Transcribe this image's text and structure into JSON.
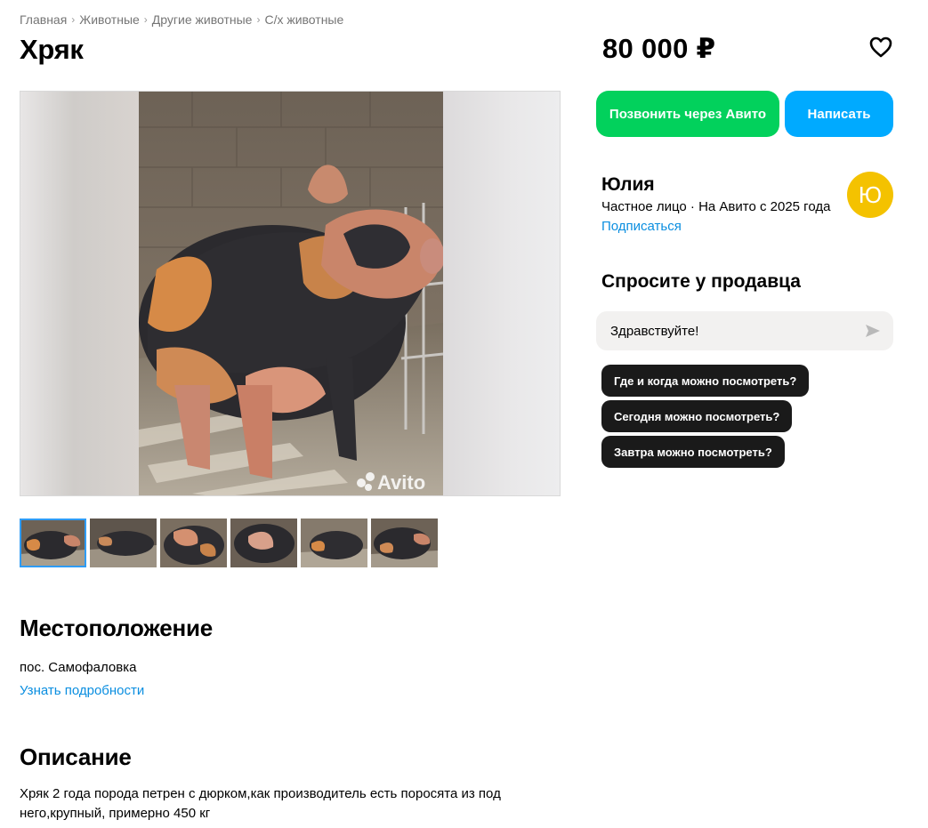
{
  "breadcrumb": [
    "Главная",
    "Животные",
    "Другие животные",
    "С/х животные"
  ],
  "listing": {
    "title": "Хряк",
    "price": "80 000 ₽"
  },
  "gallery": {
    "watermark": "Avito",
    "thumbnail_count": 6,
    "active_thumbnail": 1
  },
  "actions": {
    "call_label": "Позвонить через Авито",
    "write_label": "Написать",
    "favorite_icon": "heart-icon"
  },
  "seller": {
    "name": "Юлия",
    "info": "Частное лицо · На Авито с 2025 года",
    "subscribe_label": "Подписаться",
    "avatar_letter": "Ю",
    "avatar_color": "#f4c200"
  },
  "ask": {
    "heading": "Спросите у продавца",
    "input_value": "Здравствуйте!",
    "quick_questions": [
      "Где и когда можно посмотреть?",
      "Сегодня можно посмотреть?",
      "Завтра можно посмотреть?"
    ]
  },
  "location": {
    "heading": "Местоположение",
    "address": "пос. Самофаловка",
    "details_link": "Узнать подробности"
  },
  "description": {
    "heading": "Описание",
    "text": "Хряк 2 года порода петрен с дюрком,как производитель есть поросята из под него,крупный, примерно 450 кг"
  },
  "colors": {
    "call_button": "#02d15c",
    "write_button": "#00aaff",
    "link": "#0a8ee0",
    "chip": "#1a1a1a"
  }
}
